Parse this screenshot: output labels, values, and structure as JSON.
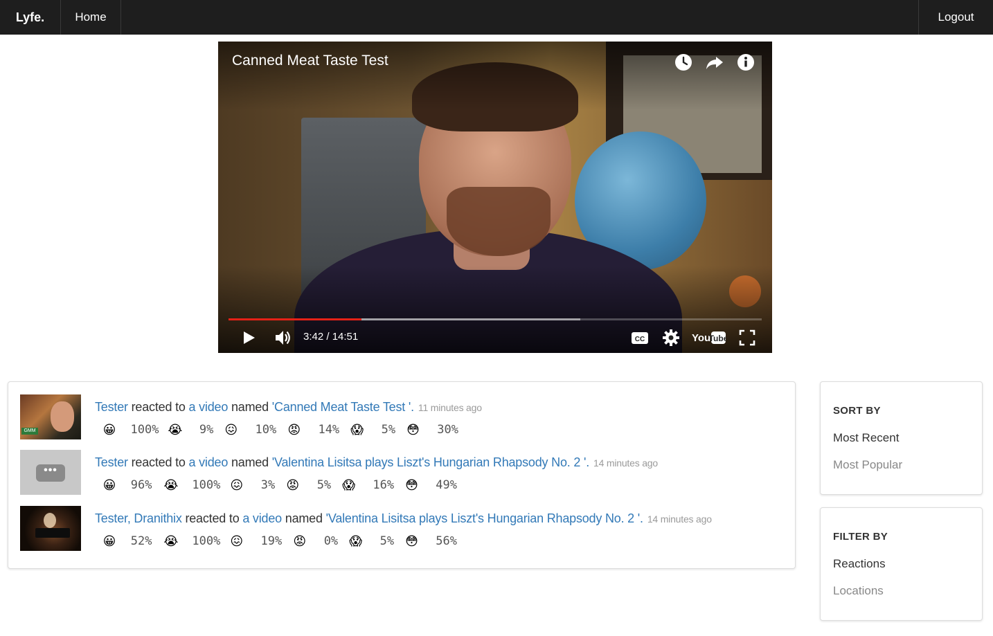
{
  "navbar": {
    "brand": "Lyfe.",
    "home": "Home",
    "logout": "Logout"
  },
  "player": {
    "title": "Canned Meat Taste Test",
    "time": "3:42 / 14:51",
    "progress_played_fraction": 0.249,
    "progress_buffered_fraction": 0.66,
    "icons": [
      "watch-later-icon",
      "share-icon",
      "info-icon",
      "play-icon",
      "volume-icon",
      "cc-icon",
      "gear-icon",
      "youtube-logo",
      "fullscreen-icon"
    ]
  },
  "feed": {
    "items": [
      {
        "users": "Tester",
        "verb": " reacted to ",
        "object": "a video",
        "named": " named ",
        "video": "'Canned Meat Taste Test '.",
        "time": "11 minutes ago",
        "reactions": [
          {
            "emoji": "😀",
            "name": "happy",
            "value": "100%"
          },
          {
            "emoji": "😭",
            "name": "sad",
            "value": "9%"
          },
          {
            "emoji": "😖",
            "name": "disgust",
            "value": "10%"
          },
          {
            "emoji": "😡",
            "name": "angry",
            "value": "14%"
          },
          {
            "emoji": "😱",
            "name": "fear",
            "value": "5%"
          },
          {
            "emoji": "😳",
            "name": "surprise",
            "value": "30%"
          }
        ]
      },
      {
        "users": "Tester",
        "verb": " reacted to ",
        "object": "a video",
        "named": " named ",
        "video": "'Valentina Lisitsa plays Liszt's Hungarian Rhapsody No. 2 '.",
        "time": "14 minutes ago",
        "reactions": [
          {
            "emoji": "😀",
            "name": "happy",
            "value": "96%"
          },
          {
            "emoji": "😭",
            "name": "sad",
            "value": "100%"
          },
          {
            "emoji": "😖",
            "name": "disgust",
            "value": "3%"
          },
          {
            "emoji": "😡",
            "name": "angry",
            "value": "5%"
          },
          {
            "emoji": "😱",
            "name": "fear",
            "value": "16%"
          },
          {
            "emoji": "😳",
            "name": "surprise",
            "value": "49%"
          }
        ]
      },
      {
        "users": "Tester, Dranithix",
        "verb": " reacted to ",
        "object": "a video",
        "named": " named ",
        "video": "'Valentina Lisitsa plays Liszt's Hungarian Rhapsody No. 2 '.",
        "time": "14 minutes ago",
        "reactions": [
          {
            "emoji": "😀",
            "name": "happy",
            "value": "52%"
          },
          {
            "emoji": "😭",
            "name": "sad",
            "value": "100%"
          },
          {
            "emoji": "😖",
            "name": "disgust",
            "value": "19%"
          },
          {
            "emoji": "😡",
            "name": "angry",
            "value": "0%"
          },
          {
            "emoji": "😱",
            "name": "fear",
            "value": "5%"
          },
          {
            "emoji": "😳",
            "name": "surprise",
            "value": "56%"
          }
        ]
      }
    ],
    "thumb_2_glyph": "•••"
  },
  "sort": {
    "heading": "SORT BY",
    "options": [
      "Most Recent",
      "Most Popular"
    ]
  },
  "filter": {
    "heading": "FILTER BY",
    "options": [
      "Reactions",
      "Locations"
    ]
  },
  "colors": {
    "navbar": "#1e1e1e",
    "link": "#3279b7",
    "progress": "#e52117",
    "muted": "#9a9a9a"
  }
}
